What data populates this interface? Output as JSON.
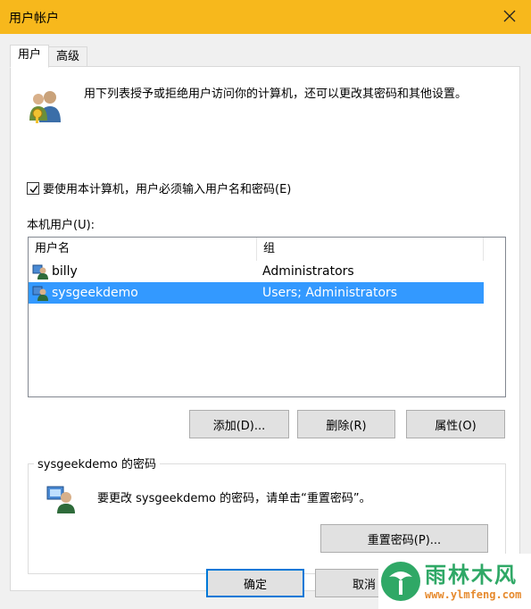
{
  "window": {
    "title": "用户帐户"
  },
  "tabs": [
    {
      "label": "用户",
      "active": true
    },
    {
      "label": "高级",
      "active": false
    }
  ],
  "intro_text": "用下列表授予或拒绝用户访问你的计算机，还可以更改其密码和其他设置。",
  "require_login": {
    "label": "要使用本计算机，用户必须输入用户名和密码(E)",
    "checked": true
  },
  "local_users_label": "本机用户(U):",
  "table": {
    "columns": [
      "用户名",
      "组"
    ],
    "rows": [
      {
        "name": "billy",
        "group": "Administrators",
        "selected": false
      },
      {
        "name": "sysgeekdemo",
        "group": "Users; Administrators",
        "selected": true
      }
    ]
  },
  "buttons": {
    "add": "添加(D)...",
    "remove": "删除(R)",
    "properties": "属性(O)",
    "reset_password": "重置密码(P)...",
    "ok": "确定",
    "cancel": "取消"
  },
  "password_group": {
    "title": "sysgeekdemo 的密码",
    "text": "要更改 sysgeekdemo 的密码，请单击“重置密码”。"
  },
  "watermark": {
    "name": "雨林木风",
    "url": "www.ylmfeng.com"
  },
  "colors": {
    "titlebar": "#f7b81c",
    "selection": "#3399ff",
    "default_button_border": "#0078d7"
  }
}
